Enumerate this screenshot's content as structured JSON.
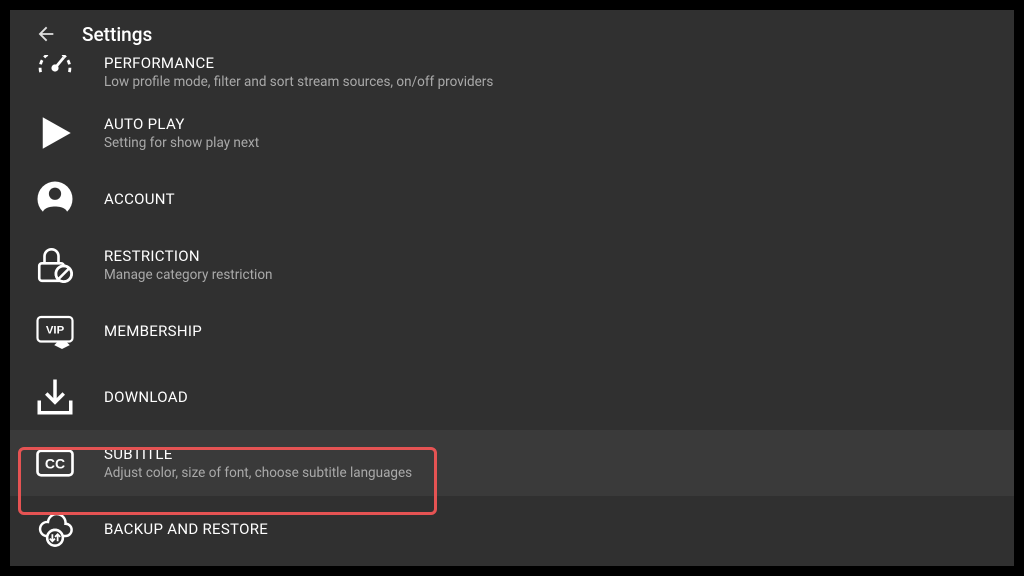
{
  "header": {
    "title": "Settings"
  },
  "items": [
    {
      "id": "performance",
      "label": "PERFORMANCE",
      "desc": "Low profile mode, filter and sort stream sources, on/off providers",
      "clipped": true
    },
    {
      "id": "autoplay",
      "label": "AUTO PLAY",
      "desc": "Setting for show play next"
    },
    {
      "id": "account",
      "label": "ACCOUNT",
      "desc": ""
    },
    {
      "id": "restriction",
      "label": "RESTRICTION",
      "desc": "Manage category restriction"
    },
    {
      "id": "membership",
      "label": "MEMBERSHIP",
      "desc": ""
    },
    {
      "id": "download",
      "label": "DOWNLOAD",
      "desc": ""
    },
    {
      "id": "subtitle",
      "label": "SUBTITLE",
      "desc": "Adjust color, size of font, choose subtitle languages",
      "selected": true,
      "highlighted": true
    },
    {
      "id": "backup",
      "label": "BACKUP AND RESTORE",
      "desc": ""
    }
  ]
}
